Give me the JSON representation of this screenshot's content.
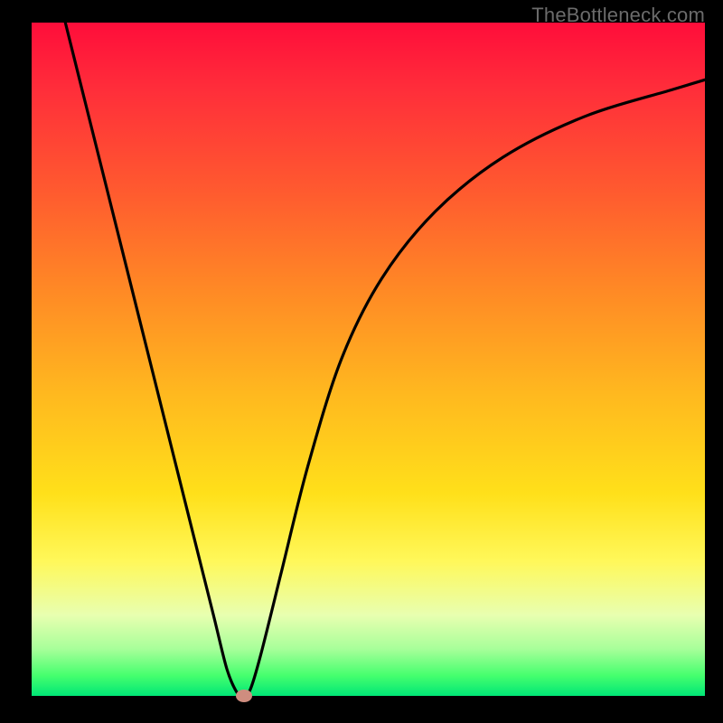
{
  "watermark": "TheBottleneck.com",
  "colors": {
    "frame_bg": "#000000",
    "curve": "#000000",
    "marker": "#cf8d7f",
    "gradient_top": "#ff0d3a",
    "gradient_bottom": "#00e676"
  },
  "chart_data": {
    "type": "line",
    "title": "",
    "xlabel": "",
    "ylabel": "",
    "xlim": [
      0,
      100
    ],
    "ylim": [
      0,
      100
    ],
    "grid": false,
    "x": [
      5,
      8,
      12,
      16,
      20,
      24,
      27,
      29,
      30.5,
      31.5,
      32.5,
      34,
      37,
      41,
      46,
      52,
      60,
      70,
      82,
      95,
      100
    ],
    "values": [
      100,
      88,
      72,
      56,
      40,
      24,
      12,
      4,
      0.5,
      0,
      1,
      6,
      18,
      34,
      50,
      62,
      72,
      80,
      86,
      90,
      91.5
    ],
    "marker": {
      "x": 31.5,
      "y": 0
    },
    "note": "Values read approximately from unlabeled axes; represents a V/checkmark-shaped bottleneck curve with minimum near x≈31.5."
  }
}
